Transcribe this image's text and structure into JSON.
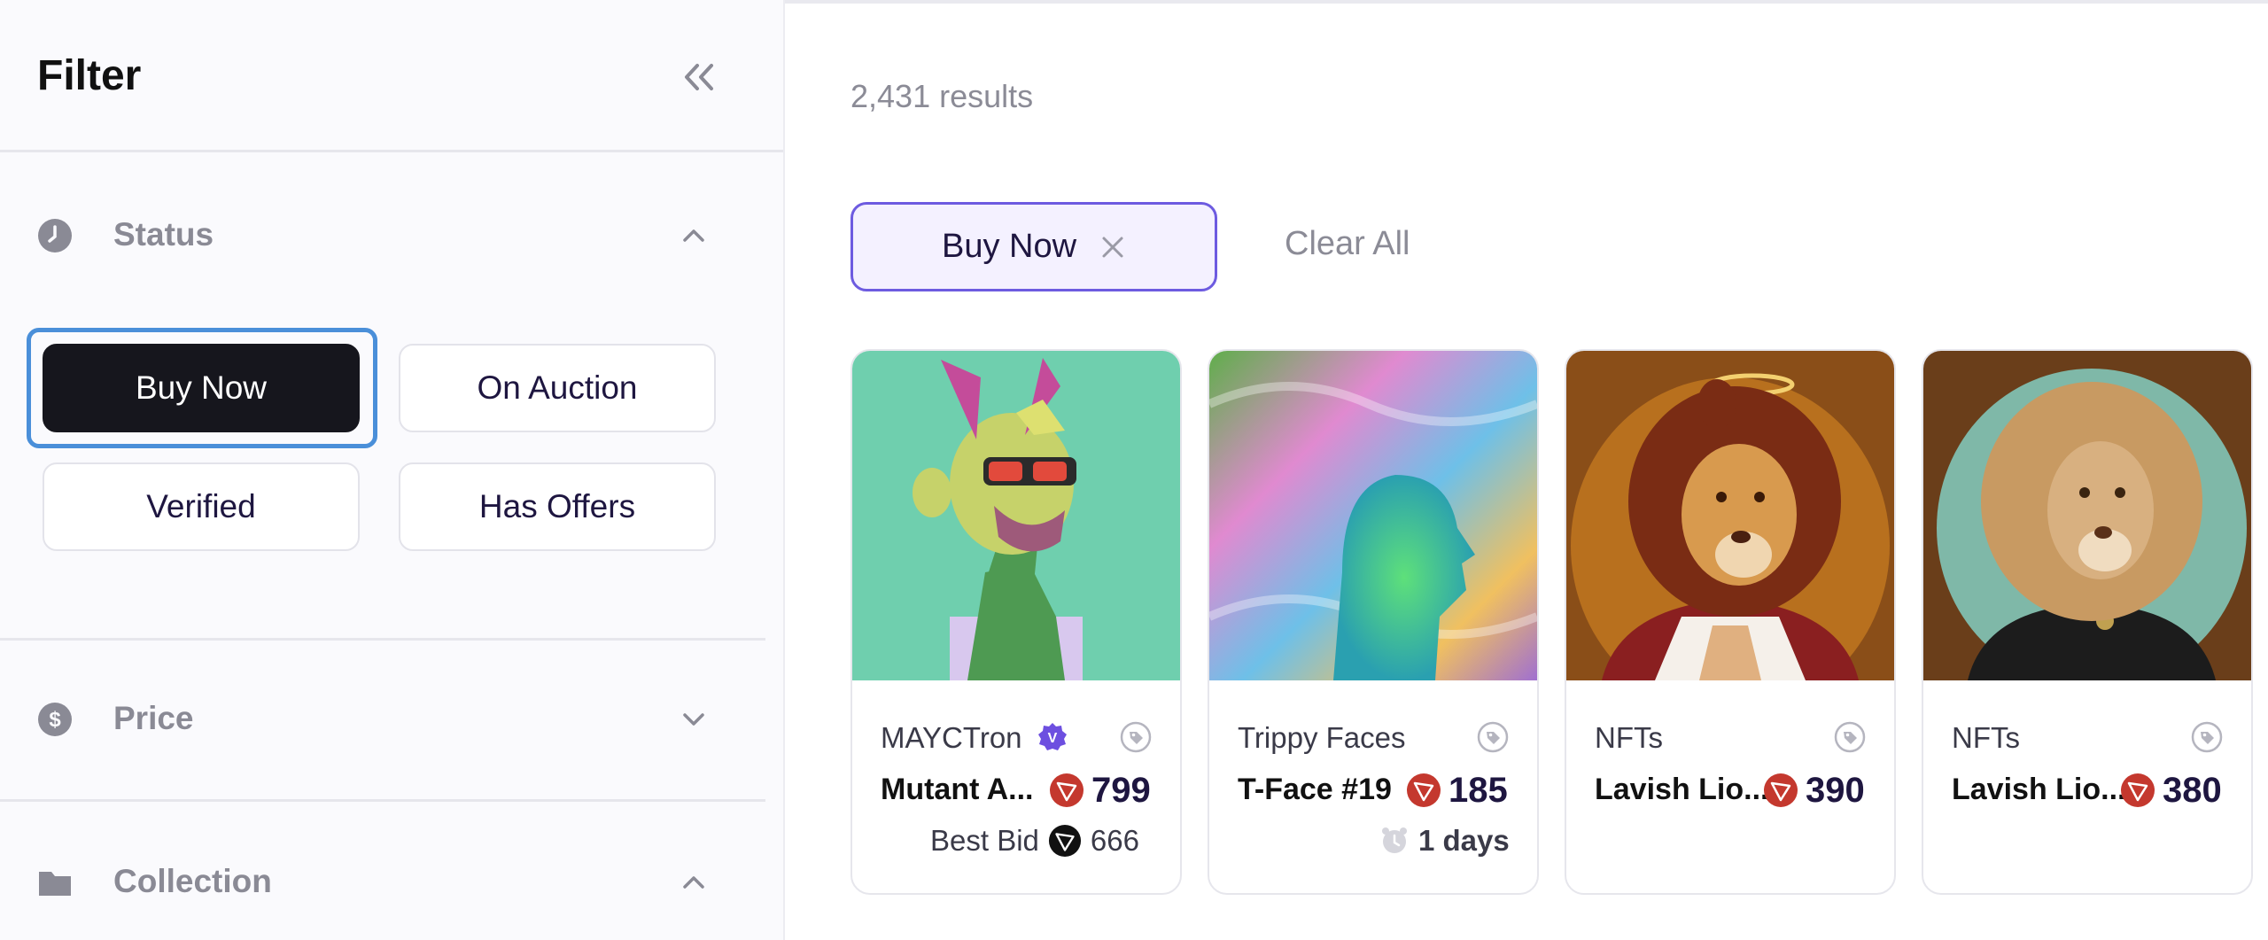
{
  "sidebar": {
    "title": "Filter",
    "sections": {
      "status": {
        "label": "Status"
      },
      "price": {
        "label": "Price"
      },
      "collection": {
        "label": "Collection"
      }
    },
    "status_buttons": {
      "buy_now": "Buy Now",
      "on_auction": "On Auction",
      "verified": "Verified",
      "has_offers": "Has Offers"
    }
  },
  "main": {
    "results_count": "2,431 results",
    "active_filter": "Buy Now",
    "clear_all": "Clear All"
  },
  "cards": [
    {
      "collection": "MAYCTron",
      "name": "Mutant A...",
      "price": "799",
      "sub_label": "Best Bid",
      "sub_value": "666"
    },
    {
      "collection": "Trippy Faces",
      "name": "T-Face #19",
      "price": "185",
      "sub_value": "1 days"
    },
    {
      "collection": "NFTs",
      "name": "Lavish Lio...",
      "price": "390"
    },
    {
      "collection": "NFTs",
      "name": "Lavish Lio...",
      "price": "380"
    }
  ],
  "colors": {
    "accent": "#6d5be0",
    "tron_red": "#c4382e",
    "active_button": "#16161d",
    "focus_ring": "#4a8fd9"
  }
}
